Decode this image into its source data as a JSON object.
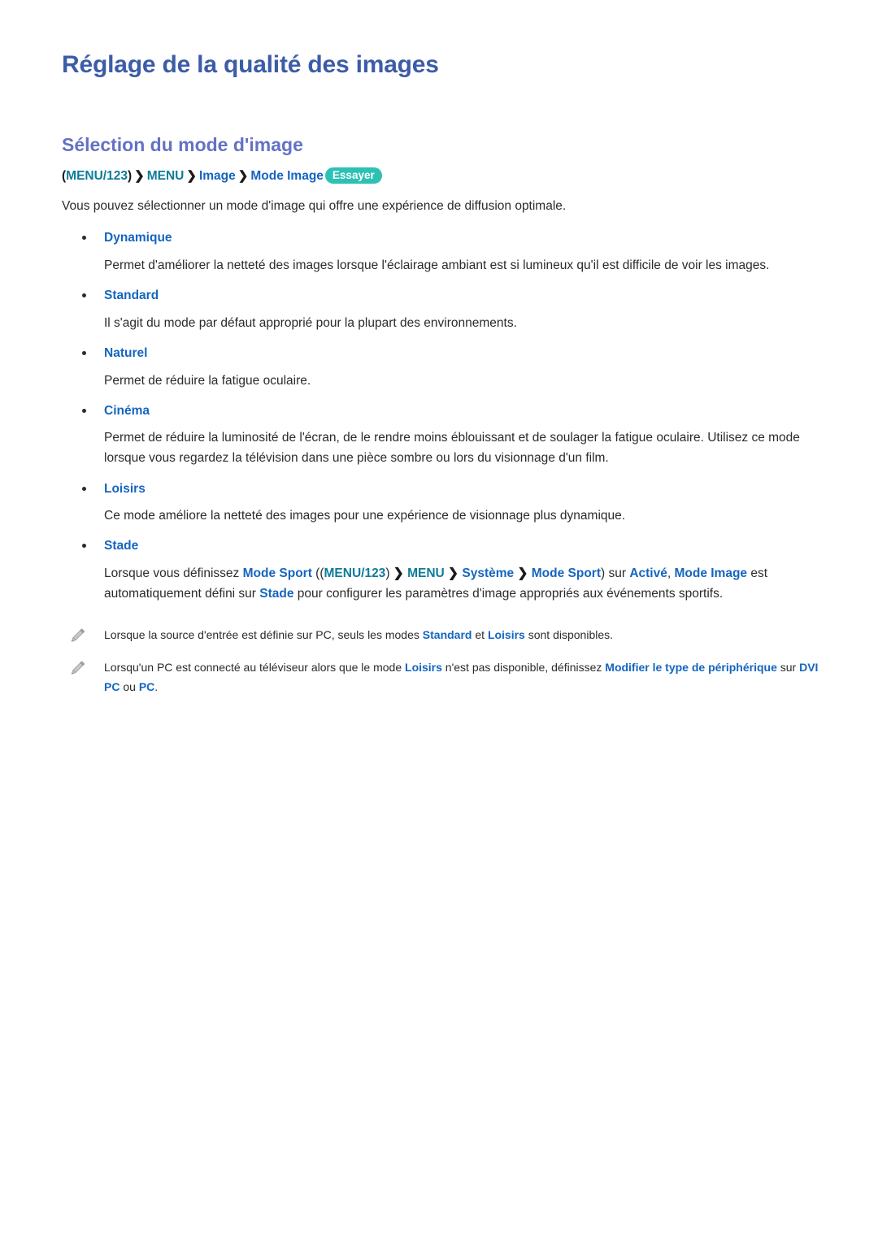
{
  "document": {
    "title": "Réglage de la qualité des images",
    "section_title": "Sélection du mode d'image"
  },
  "breadcrumb": {
    "open_paren": "(",
    "menu123": "MENU/123",
    "close_paren": ")",
    "chevron": "❯",
    "menu": "MENU",
    "image": "Image",
    "mode_image": "Mode Image",
    "try_badge": "Essayer"
  },
  "intro": "Vous pouvez sélectionner un mode d'image qui offre une expérience de diffusion optimale.",
  "modes": [
    {
      "term": "Dynamique",
      "description": "Permet d'améliorer la netteté des images lorsque l'éclairage ambiant est si lumineux qu'il est difficile de voir les images."
    },
    {
      "term": "Standard",
      "description": "Il s'agit du mode par défaut approprié pour la plupart des environnements."
    },
    {
      "term": "Naturel",
      "description": "Permet de réduire la fatigue oculaire."
    },
    {
      "term": "Cinéma",
      "description": "Permet de réduire la luminosité de l'écran, de le rendre moins éblouissant et de soulager la fatigue oculaire. Utilisez ce mode lorsque vous regardez la télévision dans une pièce sombre ou lors du visionnage d'un film."
    },
    {
      "term": "Loisirs",
      "description": "Ce mode améliore la netteté des images pour une expérience de visionnage plus dynamique."
    },
    {
      "term": "Stade",
      "description": ""
    }
  ],
  "stade_paragraph": {
    "t1": "Lorsque vous définissez ",
    "mode_sport_1": "Mode Sport",
    "t2": " ((",
    "menu123": "MENU/123",
    "t3": ") ",
    "chevron": "❯",
    "menu": "MENU",
    "systeme": "Système",
    "mode_sport_2": "Mode Sport",
    "t4": ") sur ",
    "active": "Activé",
    "t5": ", ",
    "mode_image": "Mode Image",
    "t6": " est automatiquement défini sur ",
    "stade": "Stade",
    "t7": " pour configurer les paramètres d'image appropriés aux événements sportifs."
  },
  "notes": [
    {
      "icon": "pencil-icon",
      "t1": "Lorsque la source d'entrée est définie sur PC, seuls les modes ",
      "b1": "Standard",
      "t2": " et ",
      "b2": "Loisirs",
      "t3": " sont disponibles."
    },
    {
      "icon": "pencil-icon",
      "t1": "Lorsqu'un PC est connecté au téléviseur alors que le mode ",
      "b1": "Loisirs",
      "t2": " n'est pas disponible, définissez ",
      "b2": "Modifier le type de périphérique",
      "t3": " sur ",
      "b3": "DVI PC",
      "t4": " ou ",
      "b4": "PC",
      "t5": "."
    }
  ],
  "colors": {
    "title_blue": "#3c5ca8",
    "section_purple": "#6372c4",
    "term_blue": "#1565c0",
    "teal": "#0e7c99",
    "badge_teal": "#2cc1b4",
    "body_text": "#2b2b2b"
  }
}
